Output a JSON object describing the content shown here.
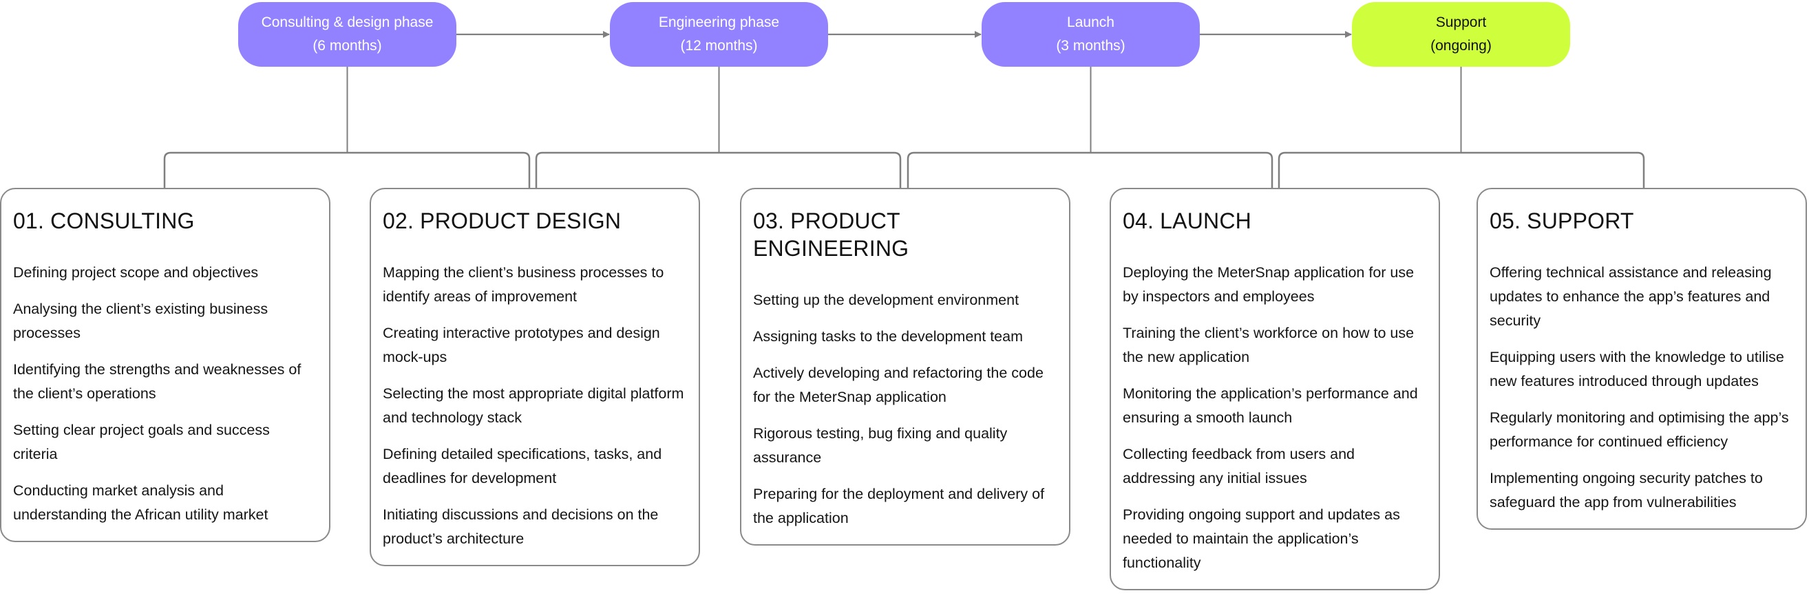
{
  "colors": {
    "phase_purple": "#9282FF",
    "phase_lime": "#CFFF3C",
    "connector": "#7f7f7f",
    "card_border": "#8a8a8a"
  },
  "phases": [
    {
      "name": "Consulting & design phase",
      "duration": "(6 months)",
      "color": "purple"
    },
    {
      "name": "Engineering phase",
      "duration": "(12 months)",
      "color": "purple"
    },
    {
      "name": "Launch",
      "duration": "(3 months)",
      "color": "purple"
    },
    {
      "name": "Support",
      "duration": "(ongoing)",
      "color": "lime"
    }
  ],
  "stages": [
    {
      "title": "01. CONSULTING",
      "items": [
        "Defining project scope and objectives",
        "Analysing the client’s existing business processes",
        "Identifying the strengths and weaknesses of the client’s operations",
        "Setting clear project goals and success criteria",
        "Conducting market analysis and understanding the African utility market"
      ]
    },
    {
      "title": "02. PRODUCT DESIGN",
      "items": [
        "Mapping the client’s business processes to identify areas of improvement",
        "Creating interactive prototypes and design mock-ups",
        "Selecting the most appropriate digital platform and technology stack",
        "Defining detailed specifications, tasks, and deadlines for development",
        "Initiating discussions and decisions on the product’s architecture"
      ]
    },
    {
      "title": "03. PRODUCT ENGINEERING",
      "items": [
        "Setting up the development environment",
        "Assigning tasks to the development team",
        "Actively developing and refactoring the code for the MeterSnap application",
        "Rigorous testing, bug fixing and quality assurance",
        "Preparing for the deployment and delivery of the application"
      ]
    },
    {
      "title": "04. LAUNCH",
      "items": [
        "Deploying the MeterSnap application for use by inspectors and employees",
        "Training the client’s workforce on how to use the new application",
        "Monitoring the application’s performance and ensuring a smooth launch",
        "Collecting feedback from users and addressing any initial issues",
        "Providing ongoing support and updates as needed to maintain the application’s functionality"
      ]
    },
    {
      "title": "05. SUPPORT",
      "items": [
        "Offering technical assistance and releasing updates to enhance the app’s features and security",
        "Equipping users with the knowledge to utilise new features introduced through updates",
        "Regularly monitoring and optimising the app’s performance for continued efficiency",
        "Implementing ongoing security patches to safeguard the app from vulnerabilities"
      ]
    }
  ]
}
